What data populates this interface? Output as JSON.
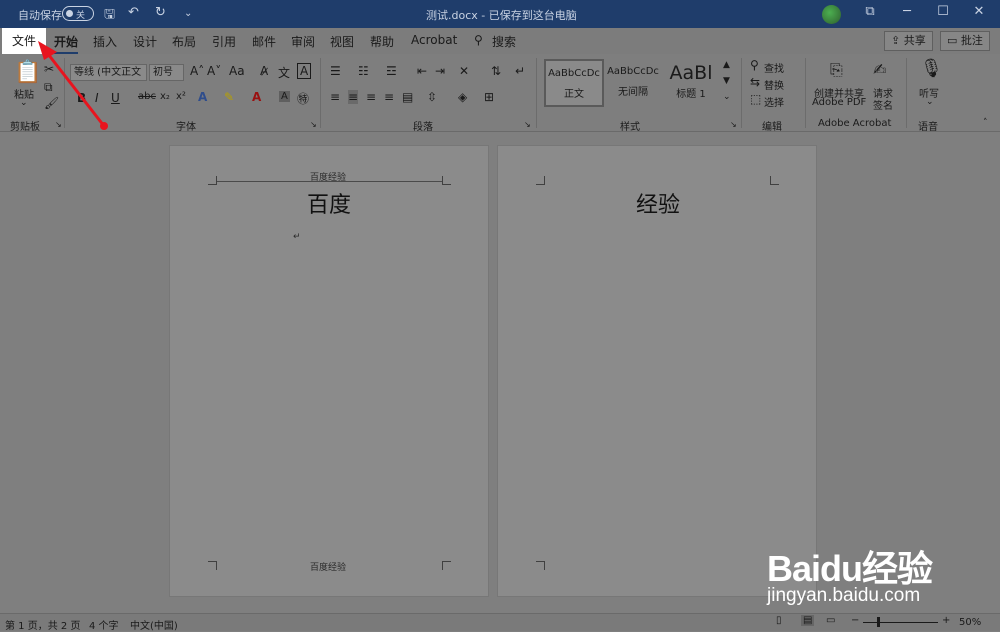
{
  "titlebar": {
    "autosave_label": "自动保存",
    "autosave_state": "关",
    "document_title": "测试.docx - 已保存到这台电脑"
  },
  "tabs": [
    "文件",
    "开始",
    "插入",
    "设计",
    "布局",
    "引用",
    "邮件",
    "审阅",
    "视图",
    "帮助",
    "Acrobat",
    "搜索"
  ],
  "share_label": "共享",
  "comment_label": "批注",
  "ribbon": {
    "clipboard": {
      "paste_label": "粘贴",
      "group_label": "剪贴板"
    },
    "font": {
      "font_name": "等线 (中文正文",
      "font_size": "初号",
      "group_label": "字体"
    },
    "paragraph": {
      "group_label": "段落"
    },
    "styles": {
      "group_label": "样式",
      "items": [
        {
          "sample": "AaBbCcDc",
          "name": "正文"
        },
        {
          "sample": "AaBbCcDc",
          "name": "无间隔"
        },
        {
          "sample": "AaBl",
          "name": "标题 1"
        }
      ]
    },
    "editing": {
      "find": "查找",
      "replace": "替换",
      "select": "选择",
      "group_label": "编辑"
    },
    "acrobat": {
      "create_line1": "创建并共享",
      "create_line2": "Adobe PDF",
      "sign_line1": "请求",
      "sign_line2": "签名",
      "group_label": "Adobe Acrobat"
    },
    "voice": {
      "dictate": "听写",
      "group_label": "语音"
    }
  },
  "pages": [
    {
      "header": "百度经验",
      "body": "百度",
      "footer": "百度经验"
    },
    {
      "body": "经验"
    }
  ],
  "status": {
    "page_info": "第 1 页，共 2 页",
    "word_count": "4 个字",
    "language": "中文(中国)",
    "zoom": "50%"
  },
  "watermark": {
    "logo": "Baidu经验",
    "url": "jingyan.baidu.com"
  },
  "annotation_color": "#e8141e"
}
